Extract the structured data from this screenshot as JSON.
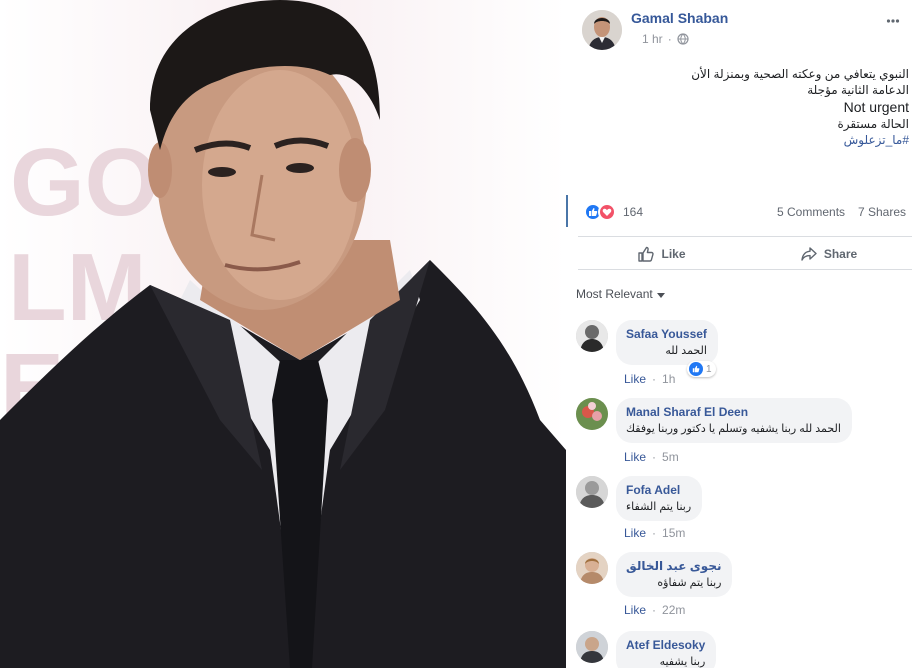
{
  "photo": {
    "backdrop_text": [
      "GO",
      "LM",
      "EST"
    ],
    "backdrop_color": "#f5e6ea"
  },
  "post": {
    "author": "Gamal Shaban",
    "time": "1 hr",
    "privacy_icon": "globe-icon",
    "more_icon": "more-horizontal-icon",
    "lines": [
      "النبوي يتعافي من وعكته الصحية وبمنزلة الأن",
      "الدعامة الثانية مؤجلة",
      "Not urgent",
      "الحالة مستقرة",
      "#ما_تزعلوش"
    ]
  },
  "reactions": {
    "count": "164",
    "types": [
      "like-icon",
      "love-icon"
    ],
    "comments": "5 Comments",
    "shares": "7 Shares"
  },
  "actions": {
    "like": "Like",
    "share": "Share"
  },
  "sort": {
    "label": "Most Relevant"
  },
  "comments": [
    {
      "name": "Safaa Youssef",
      "text": "الحمد لله",
      "like": "Like",
      "time": "1h",
      "reactions": "1"
    },
    {
      "name": "Manal Sharaf El Deen",
      "text": "الحمد لله ربنا يشفيه وتسلم يا دكتور وربنا يوفقك",
      "like": "Like",
      "time": "5m"
    },
    {
      "name": "Fofa Adel",
      "text": "ربنا يتم الشفاء",
      "like": "Like",
      "time": "15m"
    },
    {
      "name": "نجوى عبد الخالق",
      "text": "ربنا يتم شفاؤه",
      "like": "Like",
      "time": "22m"
    },
    {
      "name": "Atef Eldesoky",
      "text": "ربنا يشفيه"
    }
  ],
  "colors": {
    "link_blue": "#385898",
    "author_blue": "#365899",
    "like_blue": "#2078f4",
    "love_red": "#f25268",
    "meta_gray": "#90949c",
    "bubble_bg": "#f2f3f5"
  }
}
